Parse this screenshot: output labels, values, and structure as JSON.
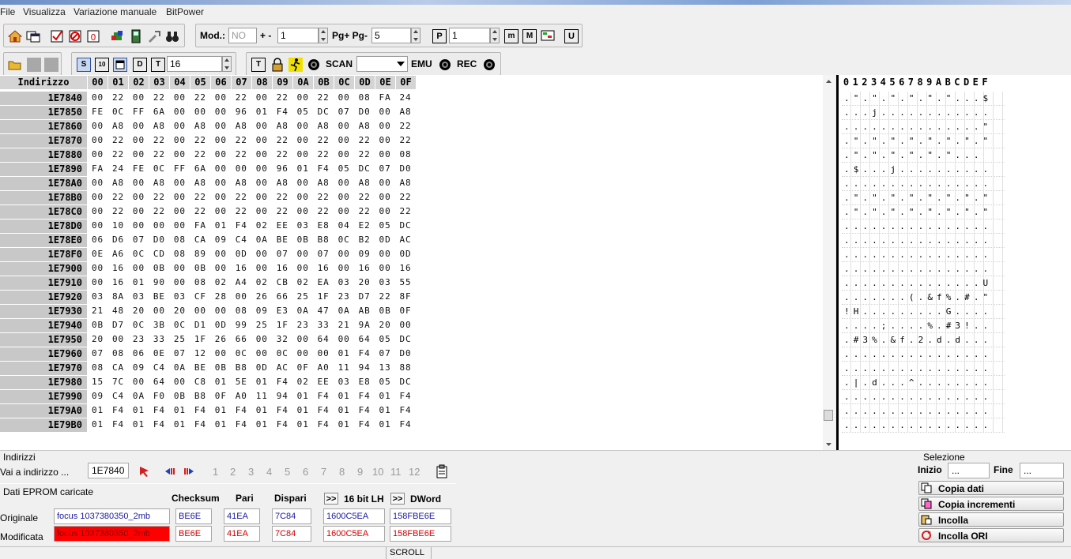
{
  "menu": [
    "File",
    "Visualizza",
    "Variazione manuale",
    "BitPower"
  ],
  "toolbar": {
    "mod_label": "Mod.:",
    "mod_value": "NO",
    "plusminus_label": "+ -",
    "step_value": "1",
    "pg_label": "Pg+ Pg-",
    "pg_value": "5",
    "p_value": "1",
    "size_value": "16",
    "scan_label": "SCAN",
    "emu_label": "EMU",
    "rec_label": "REC"
  },
  "hex": {
    "header_label": "Indirizzo",
    "columns": [
      "00",
      "01",
      "02",
      "03",
      "04",
      "05",
      "06",
      "07",
      "08",
      "09",
      "0A",
      "0B",
      "0C",
      "0D",
      "0E",
      "0F"
    ],
    "rows": [
      {
        "addr": "1E7840",
        "bytes": "00 22 00 22 00 22 00 22 00 22 00 22 00 08 FA 24"
      },
      {
        "addr": "1E7850",
        "bytes": "FE 0C FF 6A 00 00 00 96 01 F4 05 DC 07 D0 00 A8"
      },
      {
        "addr": "1E7860",
        "bytes": "00 A8 00 A8 00 A8 00 A8 00 A8 00 A8 00 A8 00 22"
      },
      {
        "addr": "1E7870",
        "bytes": "00 22 00 22 00 22 00 22 00 22 00 22 00 22 00 22"
      },
      {
        "addr": "1E7880",
        "bytes": "00 22 00 22 00 22 00 22 00 22 00 22 00 22 00 08"
      },
      {
        "addr": "1E7890",
        "bytes": "FA 24 FE 0C FF 6A 00 00 00 96 01 F4 05 DC 07 D0"
      },
      {
        "addr": "1E78A0",
        "bytes": "00 A8 00 A8 00 A8 00 A8 00 A8 00 A8 00 A8 00 A8"
      },
      {
        "addr": "1E78B0",
        "bytes": "00 22 00 22 00 22 00 22 00 22 00 22 00 22 00 22"
      },
      {
        "addr": "1E78C0",
        "bytes": "00 22 00 22 00 22 00 22 00 22 00 22 00 22 00 22"
      },
      {
        "addr": "1E78D0",
        "bytes": "00 10 00 00 00 FA 01 F4 02 EE 03 E8 04 E2 05 DC"
      },
      {
        "addr": "1E78E0",
        "bytes": "06 D6 07 D0 08 CA 09 C4 0A BE 0B B8 0C B2 0D AC"
      },
      {
        "addr": "1E78F0",
        "bytes": "0E A6 0C CD 08 89 00 0D 00 07 00 07 00 09 00 0D"
      },
      {
        "addr": "1E7900",
        "bytes": "00 16 00 0B 00 0B 00 16 00 16 00 16 00 16 00 16"
      },
      {
        "addr": "1E7910",
        "bytes": "00 16 01 90 00 08 02 A4 02 CB 02 EA 03 20 03 55"
      },
      {
        "addr": "1E7920",
        "bytes": "03 8A 03 BE 03 CF 28 00 26 66 25 1F 23 D7 22 8F"
      },
      {
        "addr": "1E7930",
        "bytes": "21 48 20 00 20 00 00 08 09 E3 0A 47 0A AB 0B 0F"
      },
      {
        "addr": "1E7940",
        "bytes": "0B D7 0C 3B 0C D1 0D 99 25 1F 23 33 21 9A 20 00"
      },
      {
        "addr": "1E7950",
        "bytes": "20 00 23 33 25 1F 26 66 00 32 00 64 00 64 05 DC"
      },
      {
        "addr": "1E7960",
        "bytes": "07 08 06 0E 07 12 00 0C 00 0C 00 00 01 F4 07 D0"
      },
      {
        "addr": "1E7970",
        "bytes": "08 CA 09 C4 0A BE 0B B8 0D AC 0F A0 11 94 13 88"
      },
      {
        "addr": "1E7980",
        "bytes": "15 7C 00 64 00 C8 01 5E 01 F4 02 EE 03 E8 05 DC"
      },
      {
        "addr": "1E7990",
        "bytes": "09 C4 0A F0 0B B8 0F A0 11 94 01 F4 01 F4 01 F4"
      },
      {
        "addr": "1E79A0",
        "bytes": "01 F4 01 F4 01 F4 01 F4 01 F4 01 F4 01 F4 01 F4"
      },
      {
        "addr": "1E79B0",
        "bytes": "01 F4 01 F4 01 F4 01 F4 01 F4 01 F4 01 F4 01 F4"
      }
    ]
  },
  "ascii": {
    "columns": [
      "0",
      "1",
      "2",
      "3",
      "4",
      "5",
      "6",
      "7",
      "8",
      "9",
      "A",
      "B",
      "C",
      "D",
      "E",
      "F"
    ],
    "rows": [
      ".\".\".\".\".\".\"...$",
      "...j............",
      "...............\"",
      ".\".\".\".\".\".\".\".\"",
      ".\".\".\".\".\".\"...",
      ".$...j..........",
      "................",
      ".\".\".\".\".\".\".\".\"",
      ".\".\".\".\".\".\".\".\"",
      "................",
      "................",
      "................",
      "................",
      "...............U",
      ".......(.&f%.#.\"",
      "!H.........G....",
      "....;....%.#3!..",
      ".#3%.&f.2.d.d...",
      "................",
      "................",
      ".|.d...^........",
      "................",
      "................",
      "................"
    ]
  },
  "nav": {
    "section_label": "Indirizzi",
    "goto_label": "Vai a indirizzo ...",
    "address_value": "1E7840",
    "pages": [
      "1",
      "2",
      "3",
      "4",
      "5",
      "6",
      "7",
      "8",
      "9",
      "10",
      "11",
      "12"
    ]
  },
  "eprom": {
    "section_label": "Dati EPROM caricate",
    "col_checksum": "Checksum",
    "col_pari": "Pari",
    "col_dispari": "Dispari",
    "col_16bit": "16 bit LH",
    "col_dword": "DWord",
    "expand_label": ">>",
    "rows": [
      {
        "label": "Originale",
        "file": "focus 1037380350_2mb",
        "checksum": "BE6E",
        "pari": "41EA",
        "dispari": "7C84",
        "lh16": "1600C5EA",
        "dword": "158FBE6E"
      },
      {
        "label": "Modificata",
        "file": "focus 1037380350_2mb",
        "checksum": "BE6E",
        "pari": "41EA",
        "dispari": "7C84",
        "lh16": "1600C5EA",
        "dword": "158FBE6E"
      }
    ],
    "modified_color": "#ff0000"
  },
  "selection": {
    "section_label": "Selezione",
    "start_label": "Inizio",
    "start_value": "...",
    "end_label": "Fine",
    "end_value": "...",
    "buttons": [
      "Copia dati",
      "Copia incrementi",
      "Incolla",
      "Incolla ORI"
    ]
  },
  "status": {
    "scroll": "SCROLL"
  }
}
